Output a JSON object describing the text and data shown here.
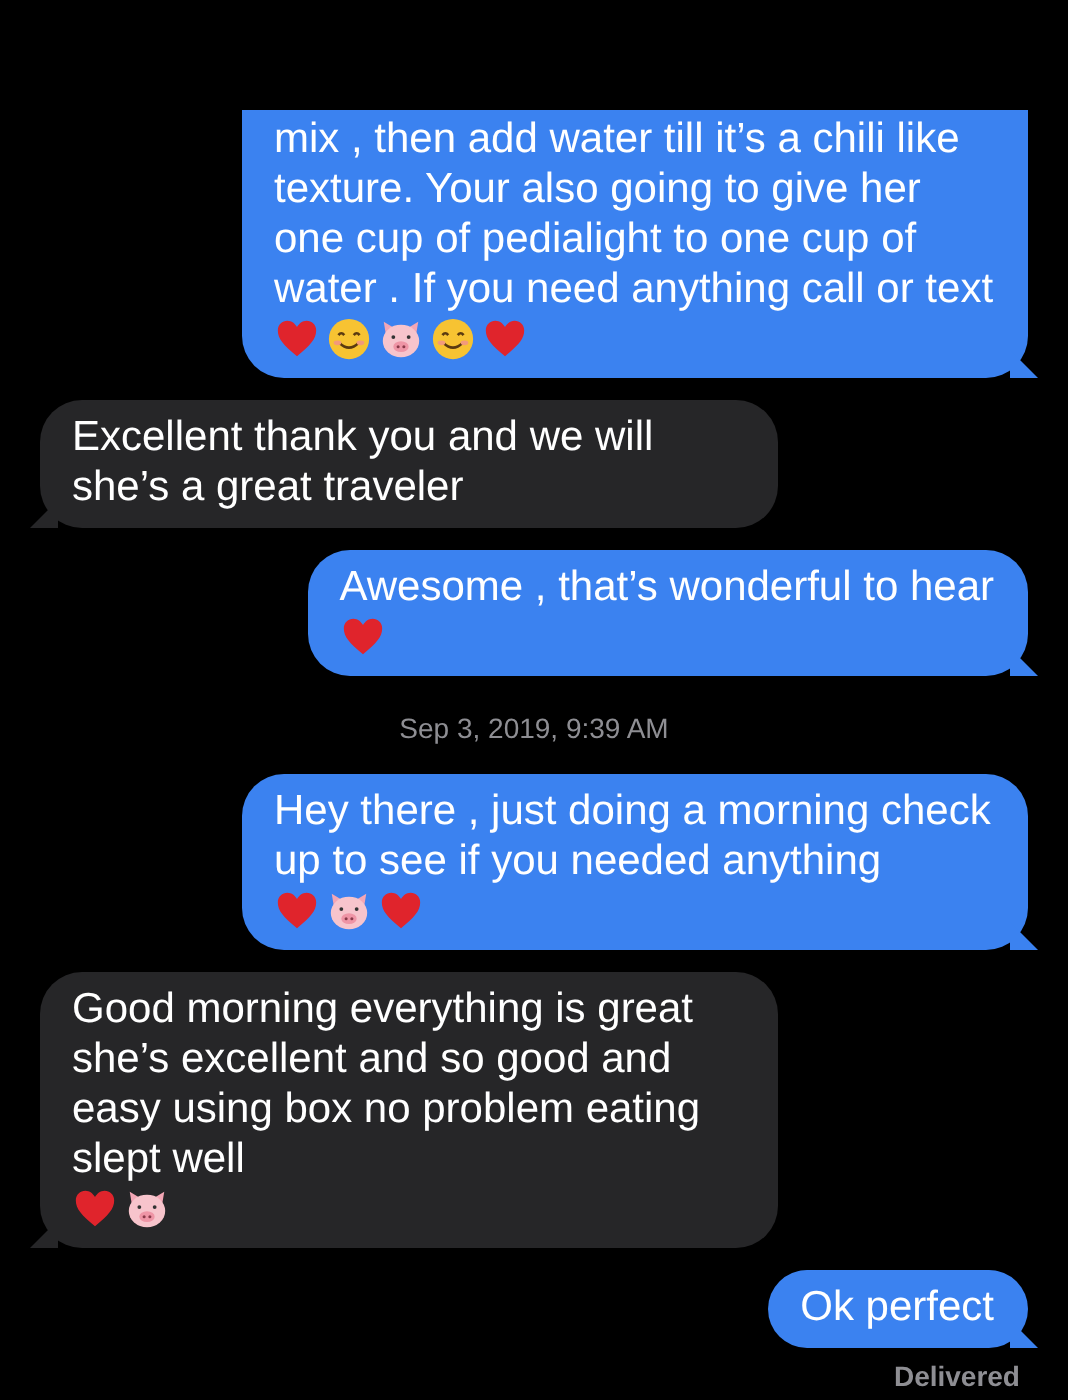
{
  "messages": [
    {
      "kind": "sent",
      "text": "mix , then add water till it’s a chili like texture. Your also going to give her one cup of pedialight to one cup of water  . If you need anything call or text",
      "emojis": [
        {
          "kind": "heart"
        },
        {
          "kind": "smile"
        },
        {
          "kind": "pig"
        },
        {
          "kind": "smile"
        },
        {
          "kind": "heart"
        }
      ]
    },
    {
      "kind": "received",
      "text": "Excellent thank you and we will she’s a great traveler"
    },
    {
      "kind": "sent",
      "text": "Awesome , that’s wonderful to hear",
      "emojis": [
        {
          "kind": "heart"
        }
      ]
    },
    {
      "kind": "timestamp",
      "text": "Sep 3, 2019, 9:39 AM"
    },
    {
      "kind": "sent",
      "text": "Hey there , just doing a morning check up to see if you needed anything",
      "emojis": [
        {
          "kind": "heart"
        },
        {
          "kind": "pig"
        },
        {
          "kind": "heart"
        }
      ]
    },
    {
      "kind": "received",
      "text": "Good morning everything is great she’s excellent and so good and easy using box no problem eating slept well",
      "emojis": [
        {
          "kind": "heart"
        },
        {
          "kind": "pig"
        }
      ]
    },
    {
      "kind": "sent",
      "text": "Ok perfect"
    },
    {
      "kind": "status",
      "text": "Delivered"
    }
  ]
}
